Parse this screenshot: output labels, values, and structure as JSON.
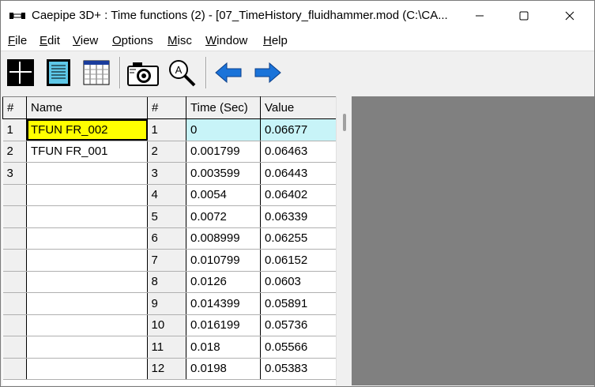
{
  "window": {
    "title": "Caepipe 3D+ : Time functions  (2)  - [07_TimeHistory_fluidhammer.mod (C:\\CA..."
  },
  "menu": {
    "items": [
      {
        "label": "File"
      },
      {
        "label": "Edit"
      },
      {
        "label": "View"
      },
      {
        "label": "Options"
      },
      {
        "label": "Misc"
      },
      {
        "label": "Window"
      },
      {
        "label": "Help"
      }
    ]
  },
  "toolbar": {
    "buttons": [
      {
        "icon": "graphics-window-icon"
      },
      {
        "icon": "text-report-icon"
      },
      {
        "icon": "spreadsheet-icon"
      },
      {
        "icon": "camera-icon"
      },
      {
        "icon": "zoom-text-icon"
      },
      {
        "icon": "back-arrow-icon"
      },
      {
        "icon": "forward-arrow-icon"
      }
    ]
  },
  "functions_table": {
    "headers": [
      "#",
      "Name"
    ],
    "rows": [
      {
        "num": "1",
        "name": "TFUN FR_002",
        "selected": true
      },
      {
        "num": "2",
        "name": "TFUN FR_001",
        "selected": false
      },
      {
        "num": "3",
        "name": "",
        "selected": false
      },
      {
        "num": "",
        "name": ""
      },
      {
        "num": "",
        "name": ""
      },
      {
        "num": "",
        "name": ""
      },
      {
        "num": "",
        "name": ""
      },
      {
        "num": "",
        "name": ""
      },
      {
        "num": "",
        "name": ""
      },
      {
        "num": "",
        "name": ""
      },
      {
        "num": "",
        "name": ""
      },
      {
        "num": "",
        "name": ""
      }
    ]
  },
  "values_table": {
    "headers": [
      "#",
      "Time (Sec)",
      "Value"
    ],
    "rows": [
      {
        "num": "1",
        "time": "0",
        "value": "0.06677"
      },
      {
        "num": "2",
        "time": "0.001799",
        "value": "0.06463"
      },
      {
        "num": "3",
        "time": "0.003599",
        "value": "0.06443"
      },
      {
        "num": "4",
        "time": "0.0054",
        "value": "0.06402"
      },
      {
        "num": "5",
        "time": "0.0072",
        "value": "0.06339"
      },
      {
        "num": "6",
        "time": "0.008999",
        "value": "0.06255"
      },
      {
        "num": "7",
        "time": "0.010799",
        "value": "0.06152"
      },
      {
        "num": "8",
        "time": "0.0126",
        "value": "0.0603"
      },
      {
        "num": "9",
        "time": "0.014399",
        "value": "0.05891"
      },
      {
        "num": "10",
        "time": "0.016199",
        "value": "0.05736"
      },
      {
        "num": "11",
        "time": "0.018",
        "value": "0.05566"
      },
      {
        "num": "12",
        "time": "0.0198",
        "value": "0.05383"
      }
    ]
  },
  "colors": {
    "selection_yellow": "#ffff00",
    "selection_cyan": "#c8f4f8",
    "mdi_background": "#808080",
    "arrow_blue": "#1a73d9"
  }
}
